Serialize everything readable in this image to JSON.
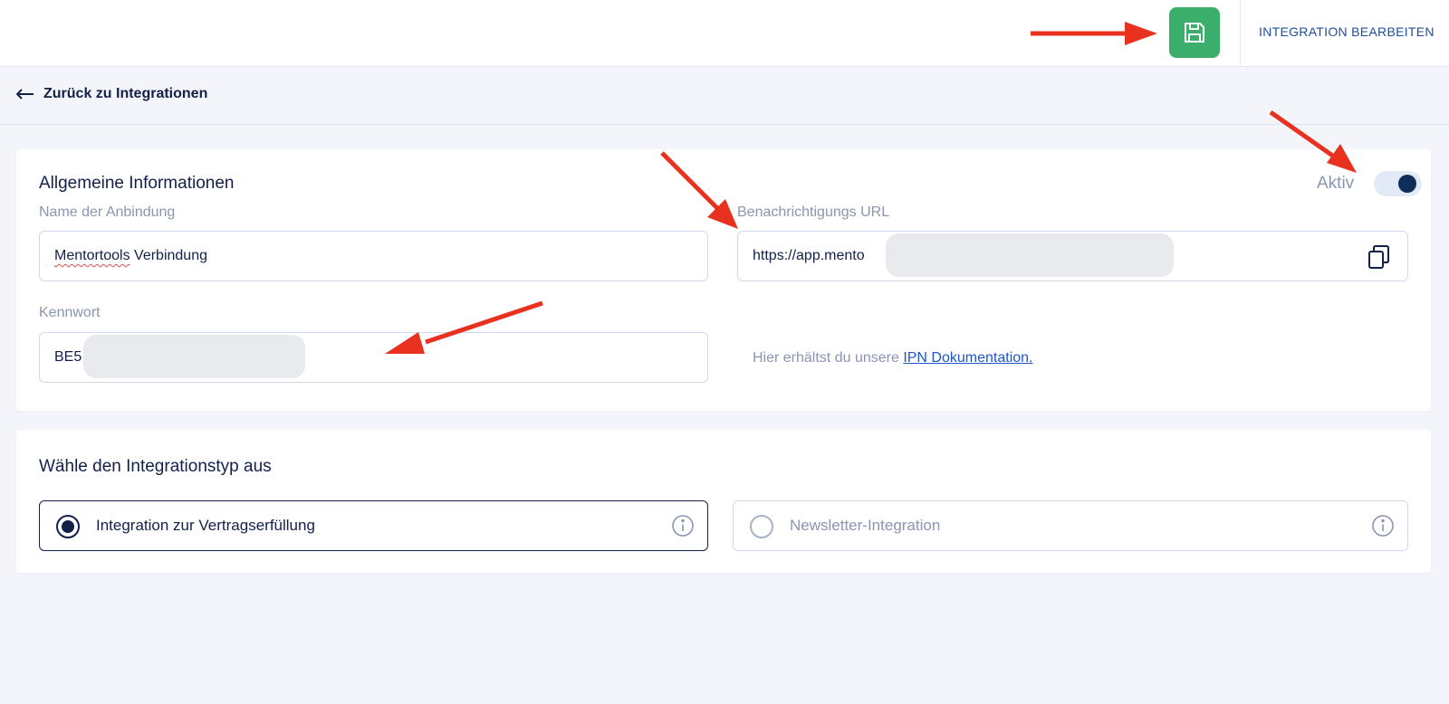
{
  "header": {
    "title": "INTEGRATION BEARBEITEN",
    "save_icon": "save-icon",
    "accent_color": "#3aae6a"
  },
  "nav": {
    "back_label": "Zurück zu Integrationen",
    "back_icon": "arrow-left-icon"
  },
  "general": {
    "title": "Allgemeine Informationen",
    "active_label": "Aktiv",
    "active": true,
    "name_label": "Name der Anbindung",
    "name_prefix": "Mentortools",
    "name_suffix": " Verbindung",
    "url_label": "Benachrichtigungs URL",
    "url_value": "https://app.mento",
    "password_label": "Kennwort",
    "password_value": "BE5",
    "help_text": "Hier erhältst du unsere ",
    "help_link": "IPN Dokumentation."
  },
  "integration_type": {
    "title": "Wähle den Integrationstyp aus",
    "options": [
      {
        "label": "Integration zur Vertragserfüllung",
        "selected": true
      },
      {
        "label": "Newsletter-Integration",
        "selected": false
      }
    ]
  }
}
